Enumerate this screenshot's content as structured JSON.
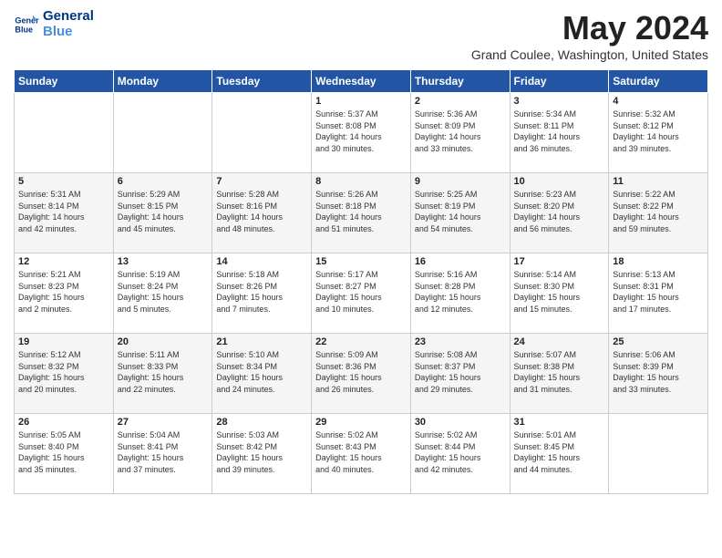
{
  "logo": {
    "line1": "General",
    "line2": "Blue"
  },
  "title": "May 2024",
  "location": "Grand Coulee, Washington, United States",
  "headers": [
    "Sunday",
    "Monday",
    "Tuesday",
    "Wednesday",
    "Thursday",
    "Friday",
    "Saturday"
  ],
  "weeks": [
    [
      {
        "day": "",
        "lines": []
      },
      {
        "day": "",
        "lines": []
      },
      {
        "day": "",
        "lines": []
      },
      {
        "day": "1",
        "lines": [
          "Sunrise: 5:37 AM",
          "Sunset: 8:08 PM",
          "Daylight: 14 hours",
          "and 30 minutes."
        ]
      },
      {
        "day": "2",
        "lines": [
          "Sunrise: 5:36 AM",
          "Sunset: 8:09 PM",
          "Daylight: 14 hours",
          "and 33 minutes."
        ]
      },
      {
        "day": "3",
        "lines": [
          "Sunrise: 5:34 AM",
          "Sunset: 8:11 PM",
          "Daylight: 14 hours",
          "and 36 minutes."
        ]
      },
      {
        "day": "4",
        "lines": [
          "Sunrise: 5:32 AM",
          "Sunset: 8:12 PM",
          "Daylight: 14 hours",
          "and 39 minutes."
        ]
      }
    ],
    [
      {
        "day": "5",
        "lines": [
          "Sunrise: 5:31 AM",
          "Sunset: 8:14 PM",
          "Daylight: 14 hours",
          "and 42 minutes."
        ]
      },
      {
        "day": "6",
        "lines": [
          "Sunrise: 5:29 AM",
          "Sunset: 8:15 PM",
          "Daylight: 14 hours",
          "and 45 minutes."
        ]
      },
      {
        "day": "7",
        "lines": [
          "Sunrise: 5:28 AM",
          "Sunset: 8:16 PM",
          "Daylight: 14 hours",
          "and 48 minutes."
        ]
      },
      {
        "day": "8",
        "lines": [
          "Sunrise: 5:26 AM",
          "Sunset: 8:18 PM",
          "Daylight: 14 hours",
          "and 51 minutes."
        ]
      },
      {
        "day": "9",
        "lines": [
          "Sunrise: 5:25 AM",
          "Sunset: 8:19 PM",
          "Daylight: 14 hours",
          "and 54 minutes."
        ]
      },
      {
        "day": "10",
        "lines": [
          "Sunrise: 5:23 AM",
          "Sunset: 8:20 PM",
          "Daylight: 14 hours",
          "and 56 minutes."
        ]
      },
      {
        "day": "11",
        "lines": [
          "Sunrise: 5:22 AM",
          "Sunset: 8:22 PM",
          "Daylight: 14 hours",
          "and 59 minutes."
        ]
      }
    ],
    [
      {
        "day": "12",
        "lines": [
          "Sunrise: 5:21 AM",
          "Sunset: 8:23 PM",
          "Daylight: 15 hours",
          "and 2 minutes."
        ]
      },
      {
        "day": "13",
        "lines": [
          "Sunrise: 5:19 AM",
          "Sunset: 8:24 PM",
          "Daylight: 15 hours",
          "and 5 minutes."
        ]
      },
      {
        "day": "14",
        "lines": [
          "Sunrise: 5:18 AM",
          "Sunset: 8:26 PM",
          "Daylight: 15 hours",
          "and 7 minutes."
        ]
      },
      {
        "day": "15",
        "lines": [
          "Sunrise: 5:17 AM",
          "Sunset: 8:27 PM",
          "Daylight: 15 hours",
          "and 10 minutes."
        ]
      },
      {
        "day": "16",
        "lines": [
          "Sunrise: 5:16 AM",
          "Sunset: 8:28 PM",
          "Daylight: 15 hours",
          "and 12 minutes."
        ]
      },
      {
        "day": "17",
        "lines": [
          "Sunrise: 5:14 AM",
          "Sunset: 8:30 PM",
          "Daylight: 15 hours",
          "and 15 minutes."
        ]
      },
      {
        "day": "18",
        "lines": [
          "Sunrise: 5:13 AM",
          "Sunset: 8:31 PM",
          "Daylight: 15 hours",
          "and 17 minutes."
        ]
      }
    ],
    [
      {
        "day": "19",
        "lines": [
          "Sunrise: 5:12 AM",
          "Sunset: 8:32 PM",
          "Daylight: 15 hours",
          "and 20 minutes."
        ]
      },
      {
        "day": "20",
        "lines": [
          "Sunrise: 5:11 AM",
          "Sunset: 8:33 PM",
          "Daylight: 15 hours",
          "and 22 minutes."
        ]
      },
      {
        "day": "21",
        "lines": [
          "Sunrise: 5:10 AM",
          "Sunset: 8:34 PM",
          "Daylight: 15 hours",
          "and 24 minutes."
        ]
      },
      {
        "day": "22",
        "lines": [
          "Sunrise: 5:09 AM",
          "Sunset: 8:36 PM",
          "Daylight: 15 hours",
          "and 26 minutes."
        ]
      },
      {
        "day": "23",
        "lines": [
          "Sunrise: 5:08 AM",
          "Sunset: 8:37 PM",
          "Daylight: 15 hours",
          "and 29 minutes."
        ]
      },
      {
        "day": "24",
        "lines": [
          "Sunrise: 5:07 AM",
          "Sunset: 8:38 PM",
          "Daylight: 15 hours",
          "and 31 minutes."
        ]
      },
      {
        "day": "25",
        "lines": [
          "Sunrise: 5:06 AM",
          "Sunset: 8:39 PM",
          "Daylight: 15 hours",
          "and 33 minutes."
        ]
      }
    ],
    [
      {
        "day": "26",
        "lines": [
          "Sunrise: 5:05 AM",
          "Sunset: 8:40 PM",
          "Daylight: 15 hours",
          "and 35 minutes."
        ]
      },
      {
        "day": "27",
        "lines": [
          "Sunrise: 5:04 AM",
          "Sunset: 8:41 PM",
          "Daylight: 15 hours",
          "and 37 minutes."
        ]
      },
      {
        "day": "28",
        "lines": [
          "Sunrise: 5:03 AM",
          "Sunset: 8:42 PM",
          "Daylight: 15 hours",
          "and 39 minutes."
        ]
      },
      {
        "day": "29",
        "lines": [
          "Sunrise: 5:02 AM",
          "Sunset: 8:43 PM",
          "Daylight: 15 hours",
          "and 40 minutes."
        ]
      },
      {
        "day": "30",
        "lines": [
          "Sunrise: 5:02 AM",
          "Sunset: 8:44 PM",
          "Daylight: 15 hours",
          "and 42 minutes."
        ]
      },
      {
        "day": "31",
        "lines": [
          "Sunrise: 5:01 AM",
          "Sunset: 8:45 PM",
          "Daylight: 15 hours",
          "and 44 minutes."
        ]
      },
      {
        "day": "",
        "lines": []
      }
    ]
  ]
}
